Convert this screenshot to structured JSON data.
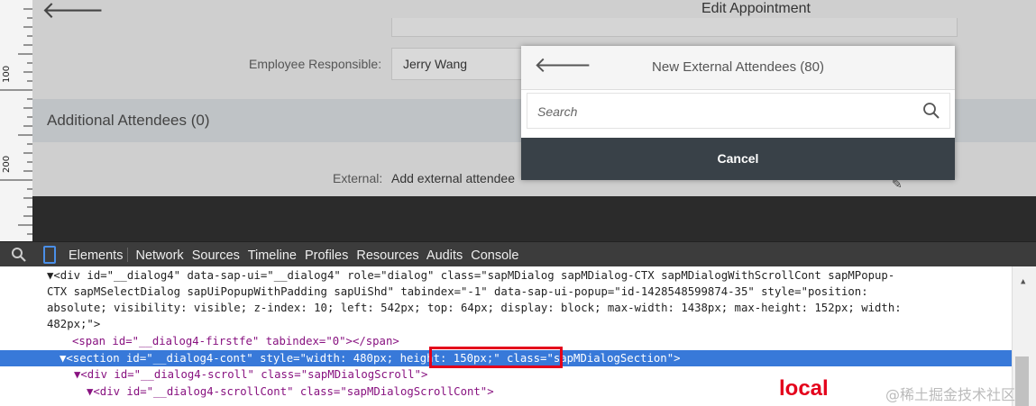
{
  "ruler": {
    "marks": [
      "100",
      "200"
    ]
  },
  "app": {
    "edit_title": "Edit Appointment",
    "employee_label": "Employee Responsible:",
    "employee_value": "Jerry Wang",
    "additional_title": "Additional Attendees (0)",
    "external_label": "External:",
    "external_value": "Add external attendee"
  },
  "dialog": {
    "title": "New External Attendees (80)",
    "search_placeholder": "Search",
    "cancel_label": "Cancel"
  },
  "devtools": {
    "tabs": [
      "Elements",
      "Network",
      "Sources",
      "Timeline",
      "Profiles",
      "Resources",
      "Audits",
      "Console"
    ],
    "lines": [
      "▼<div id=\"__dialog4\" data-sap-ui=\"__dialog4\" role=\"dialog\" class=\"sapMDialog sapMDialog-CTX sapMDialogWithScrollCont sapMPopup-",
      "CTX sapMSelectDialog sapUiPopupWithPadding sapUiShd\" tabindex=\"-1\" data-sap-ui-popup=\"id-1428548599874-35\" style=\"position:",
      "absolute; visibility: visible; z-index: 10; left: 542px; top: 64px; display: block; max-width: 1438px; max-height: 152px; width:",
      "482px;\">",
      "<span id=\"__dialog4-firstfe\" tabindex=\"0\"></span>",
      "▼<section id=\"__dialog4-cont\" style=\"width: 480px; height: 150px;\" class=\"sapMDialogSection\">",
      "▼<div id=\"__dialog4-scroll\" class=\"sapMDialogScroll\">",
      "▼<div id=\"__dialog4-scrollCont\" class=\"sapMDialogScrollCont\">"
    ]
  },
  "annotation": {
    "label": "local",
    "color": "#e4001b"
  },
  "watermark": "@稀土掘金技术社区"
}
